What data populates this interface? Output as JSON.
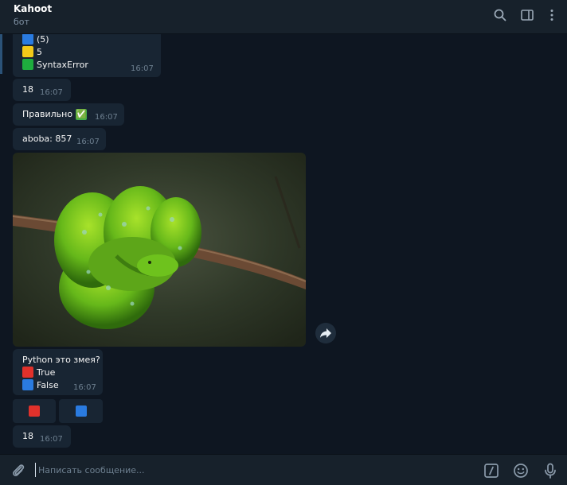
{
  "header": {
    "title": "Kahoot",
    "subtitle": "бот",
    "icons": [
      "search-icon",
      "sidebar-toggle-icon",
      "more-vertical-icon"
    ]
  },
  "messages": [
    {
      "kind": "options",
      "lines": [
        {
          "color": "blue",
          "text": "(5)"
        },
        {
          "color": "yellow",
          "text": "5"
        },
        {
          "color": "green",
          "text": "SyntaxError"
        }
      ],
      "time": "16:07"
    },
    {
      "kind": "text",
      "text": "18",
      "time": "16:07"
    },
    {
      "kind": "text",
      "text": "Правильно",
      "emoji": "✅",
      "time": "16:07"
    },
    {
      "kind": "text",
      "text": "aboba: 857",
      "time": "16:07"
    },
    {
      "kind": "photo",
      "subject": "green tree python on branch",
      "forward_icon": "forward-icon"
    },
    {
      "kind": "poll",
      "question": "Python это змея?",
      "lines": [
        {
          "color": "red",
          "text": "True"
        },
        {
          "color": "blue",
          "text": "False"
        }
      ],
      "time": "16:07"
    },
    {
      "kind": "keyboard",
      "buttons": [
        {
          "color": "red"
        },
        {
          "color": "blue"
        }
      ]
    },
    {
      "kind": "text",
      "text": "18",
      "time": "16:07"
    }
  ],
  "composer": {
    "placeholder": "Написать сообщение...",
    "icons": [
      "attach-icon",
      "bot-command-icon",
      "emoji-icon",
      "microphone-icon"
    ]
  },
  "colors": {
    "background": "#0e1621",
    "header": "#17212b",
    "bubble": "#182533",
    "time": "#6d7f8f",
    "blue": "#2a7be0",
    "yellow": "#f2c919",
    "green": "#1eac3e",
    "red": "#e0312b"
  }
}
